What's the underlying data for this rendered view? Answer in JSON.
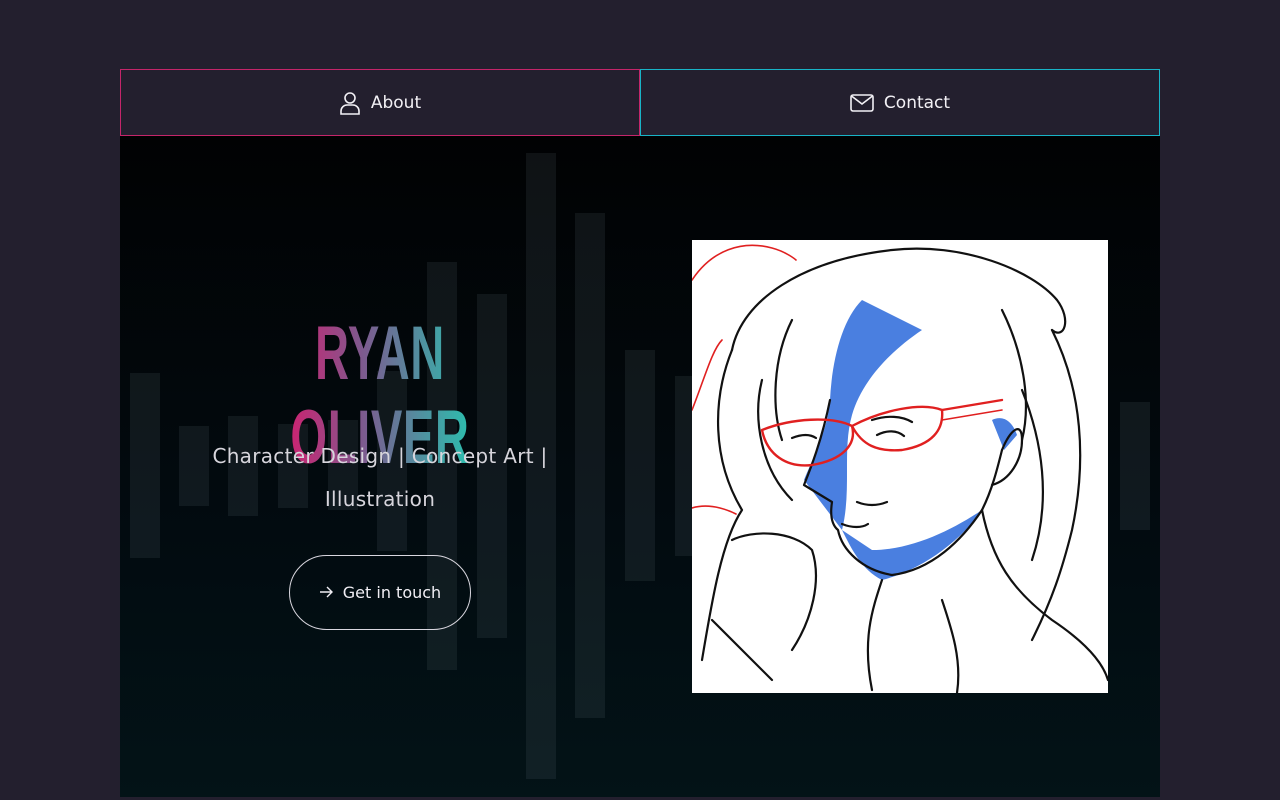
{
  "nav": {
    "about": {
      "label": "About",
      "icon": "user-icon"
    },
    "contact": {
      "label": "Contact",
      "icon": "envelope-icon"
    }
  },
  "hero": {
    "name": "RYAN OLIVER",
    "tagline_line1": "Character Design | Concept Art |",
    "tagline_line2": "Illustration",
    "cta_label": "Get in touch",
    "cta_icon": "arrow-right-icon",
    "portrait_alt": "character sketch portrait"
  },
  "colors": {
    "page_bg": "#231f2e",
    "about_border": "#c4256a",
    "contact_border": "#18b3c6",
    "gradient_start": "#d21f6f",
    "gradient_end": "#27c4b0"
  }
}
